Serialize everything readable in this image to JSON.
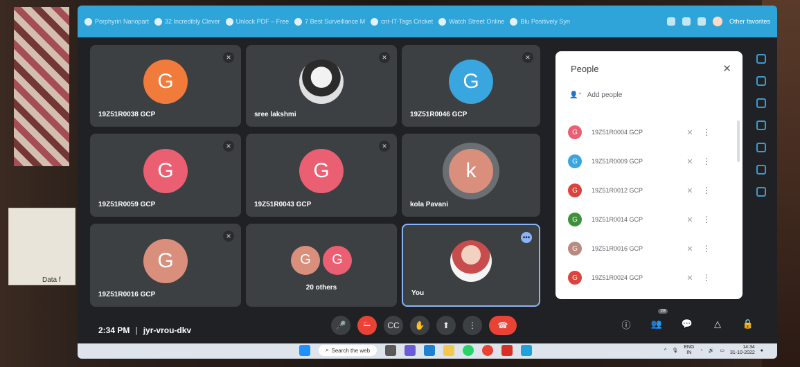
{
  "browser": {
    "bookmarks": [
      "Porphyrin Nanopart",
      "32 Incredibly Clever",
      "Unlock PDF – Free",
      "7 Best Surveillance M",
      "cnt-IT-Tags Cricket",
      "Watch Street Online",
      "Blu Positively Syn"
    ],
    "other_bookmarks": "Other favorites"
  },
  "tiles": [
    {
      "initial": "G",
      "name": "19Z51R0038 GCP",
      "color": "#f07b3a",
      "type": "avatar"
    },
    {
      "initial": "",
      "name": "sree lakshmi",
      "color": "",
      "type": "photo"
    },
    {
      "initial": "G",
      "name": "19Z51R0046 GCP",
      "color": "#3aa6e0",
      "type": "avatar"
    },
    {
      "initial": "G",
      "name": "19Z51R0059 GCP",
      "color": "#ea5f72",
      "type": "avatar"
    },
    {
      "initial": "G",
      "name": "19Z51R0043 GCP",
      "color": "#ea5f72",
      "type": "avatar"
    },
    {
      "initial": "k",
      "name": "kola Pavani",
      "color": "#d98f7b",
      "type": "ring"
    },
    {
      "initial": "G",
      "name": "19Z51R0016 GCP",
      "color": "#d98f7b",
      "type": "avatar"
    },
    {
      "initial": "G",
      "name": "20 others",
      "color": "#ea5f72",
      "type": "others"
    },
    {
      "initial": "",
      "name": "You",
      "color": "",
      "type": "you"
    }
  ],
  "others_avatars": [
    {
      "initial": "G",
      "color": "#d98f7b"
    },
    {
      "initial": "G",
      "color": "#ea5f72"
    }
  ],
  "people_panel": {
    "title": "People",
    "add_label": "Add people",
    "people": [
      {
        "initial": "G",
        "name": "19Z51R0004 GCP",
        "color": "#ea5f72"
      },
      {
        "initial": "G",
        "name": "19Z51R0009 GCP",
        "color": "#3aa6e0"
      },
      {
        "initial": "G",
        "name": "19Z51R0012 GCP",
        "color": "#d9443f"
      },
      {
        "initial": "G",
        "name": "19Z51R0014 GCP",
        "color": "#3f8f3f"
      },
      {
        "initial": "G",
        "name": "19Z51R0016 GCP",
        "color": "#b98b80"
      },
      {
        "initial": "G",
        "name": "19Z51R0024 GCP",
        "color": "#d9443f"
      }
    ]
  },
  "meeting": {
    "time": "2:34 PM",
    "code": "jyr-vrou-dkv"
  },
  "people_badge": "28",
  "taskbar": {
    "search_label": "Search the web",
    "lang_top": "ENG",
    "lang_bottom": "IN",
    "time": "14:34",
    "date": "31-10-2022"
  },
  "background_label": "Data f"
}
